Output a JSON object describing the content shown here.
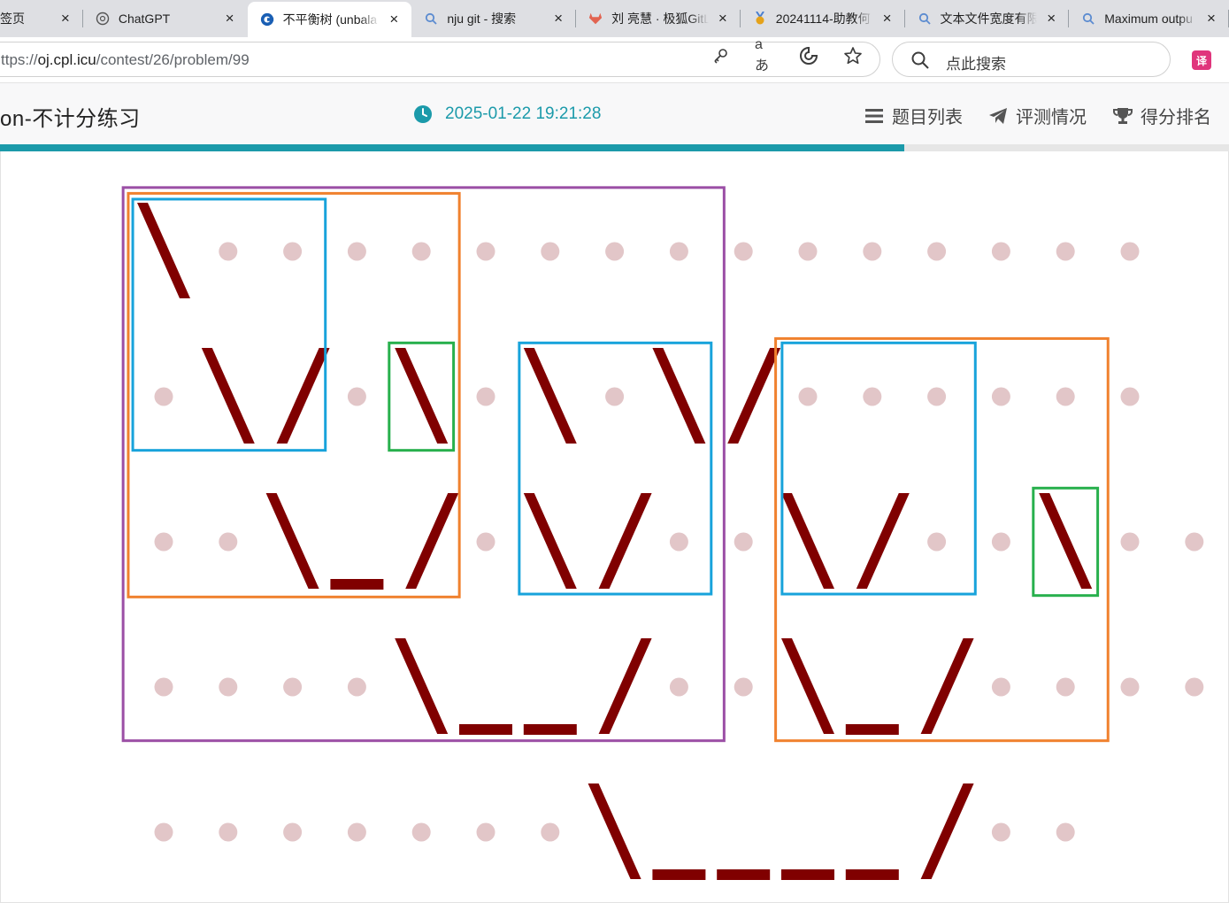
{
  "browser": {
    "tabs": [
      {
        "title": "签页",
        "favicon": "none",
        "active": false
      },
      {
        "title": "ChatGPT",
        "favicon": "chatgpt-icon",
        "active": false
      },
      {
        "title": "不平衡树 (unbala",
        "favicon": "oj-icon",
        "active": true
      },
      {
        "title": "nju git - 搜索",
        "favicon": "search-icon",
        "active": false
      },
      {
        "title": "刘 亮慧 · 极狐GitL",
        "favicon": "gitlab-icon",
        "active": false
      },
      {
        "title": "20241114-助教何",
        "favicon": "medal-icon",
        "active": false
      },
      {
        "title": "文本文件宽度有限",
        "favicon": "search-icon",
        "active": false
      },
      {
        "title": "Maximum outpu",
        "favicon": "search-icon",
        "active": false
      }
    ],
    "close_glyph": "×",
    "url_scheme": "ttps://",
    "url_host": "oj.cpl.icu",
    "url_path": "/contest/26/problem/99",
    "search_placeholder": "点此搜索",
    "address_icons": [
      "key-icon",
      "read-aloud-icon",
      "edge-refresh-icon",
      "star-icon"
    ],
    "extension_label": "译"
  },
  "navbar": {
    "contest_title": "on-不计分练习",
    "time": "2025-01-22 19:21:28",
    "links": [
      {
        "label": "题目列表",
        "icon": "list-icon"
      },
      {
        "label": "评测情况",
        "icon": "paper-plane-icon"
      },
      {
        "label": "得分排名",
        "icon": "trophy-icon"
      }
    ],
    "accent_color": "#1b9aaa",
    "progress_fraction": 0.736
  },
  "figure": {
    "colors": {
      "dot": "#e2c6c8",
      "edge": "#800000",
      "purple": "#9b4fa5",
      "orange": "#f0812e",
      "blue": "#18a3db",
      "green": "#28b04d"
    },
    "rows": [
      ".....................",
      "\\ . . . . . . . . . . . . . .",
      "",
      ""
    ],
    "grid": [
      "\\...............",
      ".\\/.\\.\\.\\/......",
      "..\\_/.\\/..\\/..\\..",
      "....\\__/..\\_/....",
      ".......\\____/.."
    ]
  }
}
